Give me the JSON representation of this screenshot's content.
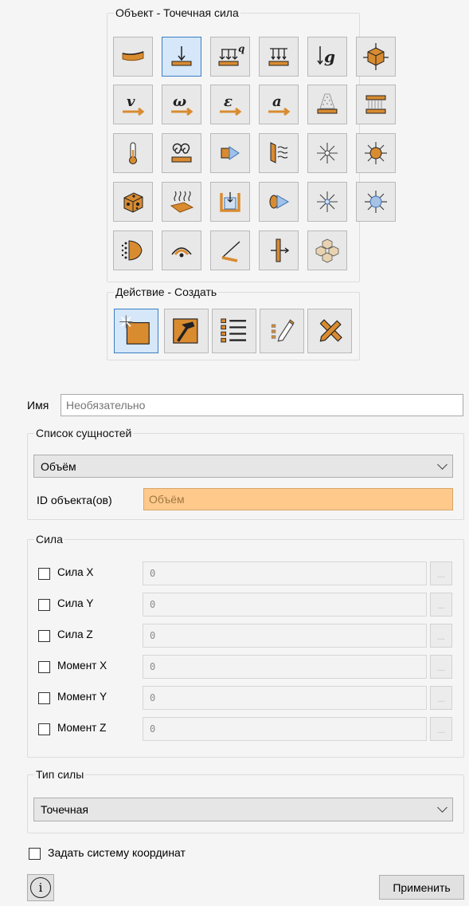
{
  "object_group": {
    "title": "Объект - Точечная сила",
    "tools": [
      {
        "icon": "beam-bend-icon"
      },
      {
        "icon": "point-force-icon",
        "selected": true
      },
      {
        "icon": "distributed-load-q-icon"
      },
      {
        "icon": "pressure-load-icon"
      },
      {
        "icon": "gravity-g-icon"
      },
      {
        "icon": "body-load-icon"
      },
      {
        "icon": "velocity-v-icon"
      },
      {
        "icon": "angular-velocity-omega-icon"
      },
      {
        "icon": "strain-epsilon-icon"
      },
      {
        "icon": "acceleration-a-icon"
      },
      {
        "icon": "shower-load-icon"
      },
      {
        "icon": "pressure-plate-icon"
      },
      {
        "icon": "temperature-icon"
      },
      {
        "icon": "heat-flux-spiral-icon"
      },
      {
        "icon": "flow-arrow-icon"
      },
      {
        "icon": "convection-wall-icon"
      },
      {
        "icon": "radiation-star-icon"
      },
      {
        "icon": "sun-radiation-icon"
      },
      {
        "icon": "cheese-block-icon"
      },
      {
        "icon": "heat-source-plate-icon"
      },
      {
        "icon": "container-load-icon"
      },
      {
        "icon": "flow-cylinder-icon"
      },
      {
        "icon": "radiation-star-blue-icon"
      },
      {
        "icon": "sun-blue-icon"
      },
      {
        "icon": "surface-mesh-icon"
      },
      {
        "icon": "eye-icon"
      },
      {
        "icon": "angle-check-icon"
      },
      {
        "icon": "bolt-preload-icon"
      },
      {
        "icon": "cube-cluster-icon"
      }
    ]
  },
  "action_group": {
    "title": "Действие - Создать",
    "tools": [
      {
        "icon": "create-sparkle-icon",
        "selected": true
      },
      {
        "icon": "modify-hammer-icon"
      },
      {
        "icon": "list-icon"
      },
      {
        "icon": "edit-pencil-icon"
      },
      {
        "icon": "delete-tools-icon"
      }
    ]
  },
  "name_row": {
    "label": "Имя",
    "placeholder": "Необязательно"
  },
  "entity_list": {
    "title": "Список сущностей",
    "selected": "Объём",
    "id_label": "ID объекта(ов)",
    "id_value": "Объём"
  },
  "force_group": {
    "title": "Сила",
    "rows": [
      {
        "label": "Сила X",
        "value": "0",
        "dots": "..."
      },
      {
        "label": "Сила Y",
        "value": "0",
        "dots": "..."
      },
      {
        "label": "Сила Z",
        "value": "0",
        "dots": "..."
      },
      {
        "label": "Момент X",
        "value": "0",
        "dots": "..."
      },
      {
        "label": "Момент Y",
        "value": "0",
        "dots": "..."
      },
      {
        "label": "Момент Z",
        "value": "0",
        "dots": "..."
      }
    ]
  },
  "force_type": {
    "title": "Тип силы",
    "selected": "Точечная"
  },
  "coord_system": {
    "label": "Задать систему координат"
  },
  "footer": {
    "apply": "Применить",
    "info": "i"
  },
  "colors": {
    "accent": "#3b7fc4",
    "id_field_bg": "#ffc98c",
    "icon_orange": "#d98b30"
  }
}
